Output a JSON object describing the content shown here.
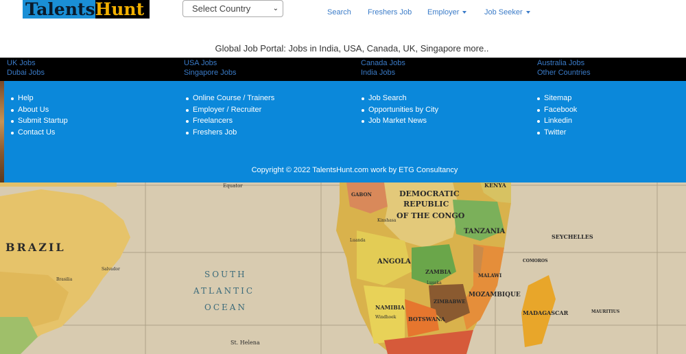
{
  "header": {
    "logo_part1": "Talents",
    "logo_part2": "Hunt",
    "country_select": "Select Country",
    "nav": {
      "search": "Search",
      "freshers": "Freshers Job",
      "employer": "Employer",
      "jobseeker": "Job Seeker"
    },
    "tagline": "Global Job Portal: Jobs in India, USA, Canada, UK, Singapore more.."
  },
  "country_jobs": [
    [
      "UK Jobs",
      "Dubai Jobs"
    ],
    [
      "USA Jobs",
      "Singapore Jobs"
    ],
    [
      "Canada Jobs",
      "India Jobs"
    ],
    [
      "Australia Jobs",
      "Other Countries"
    ]
  ],
  "footer": {
    "col1": [
      "Help",
      "About Us",
      "Submit Startup",
      "Contact Us"
    ],
    "col2": [
      "Online Course / Trainers",
      "Employer / Recruiter",
      "Freelancers",
      "Freshers Job"
    ],
    "col3": [
      "Job Search",
      "Opportunities by City",
      "Job Market News"
    ],
    "col4": [
      "Sitemap",
      "Facebook",
      "Linkedin",
      "Twitter"
    ],
    "copyright": "Copyright © 2022 TalentsHunt.com work by ETG Consultancy"
  },
  "map_labels": {
    "brazil": "BRAZIL",
    "south_atlantic_1": "SOUTH",
    "south_atlantic_2": "ATLANTIC",
    "south_atlantic_3": "OCEAN",
    "drc_1": "DEMOCRATIC",
    "drc_2": "REPUBLIC",
    "drc_3": "OF THE CONGO",
    "angola": "ANGOLA",
    "tanzania": "TANZANIA",
    "zambia": "ZAMBIA",
    "malawi": "MALAWI",
    "mozambique": "MOZAMBIQUE",
    "namibia": "NAMIBIA",
    "botswana": "BOTSWANA",
    "zimbabwe": "ZIMBABWE",
    "madagascar": "MADAGASCAR",
    "kenya": "KENYA",
    "gabon": "GABON",
    "seychelles": "SEYCHELLES",
    "st_helena": "St. Helena",
    "equator": "Equator",
    "mauritius": "MAURITIUS",
    "comoros": "COMOROS",
    "lusaka": "Lusaka",
    "windhoek": "Windhoek",
    "kinshasa": "Kinshasa",
    "luanda": "Luanda",
    "brasilia": "Brasilia",
    "salvador": "Salvador"
  },
  "colors": {
    "brand_blue": "#0b88da",
    "link_blue": "#3a7bc8",
    "band_black": "#000000"
  }
}
